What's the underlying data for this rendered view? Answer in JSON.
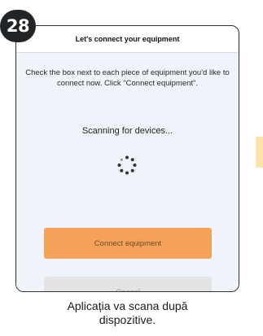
{
  "step_badge": "28",
  "dialog": {
    "title": "Let's connect your equipment",
    "instructions": "Check the box next to each piece of equipment you'd like to connect now. Click \"Connect equipment\".",
    "scanning_text": "Scanning for devices...",
    "connect_button": "Connect equipment",
    "cancel_button": "Cancel"
  },
  "caption": {
    "line1": "Aplicația va scana după",
    "line2": "dispozitive."
  },
  "colors": {
    "primary_button": "#f4a15a",
    "secondary_button": "#e3e3e3",
    "badge": "#222528",
    "side_tab": "#fde3a8"
  },
  "icons": {
    "spinner": "loading-spinner-icon"
  }
}
